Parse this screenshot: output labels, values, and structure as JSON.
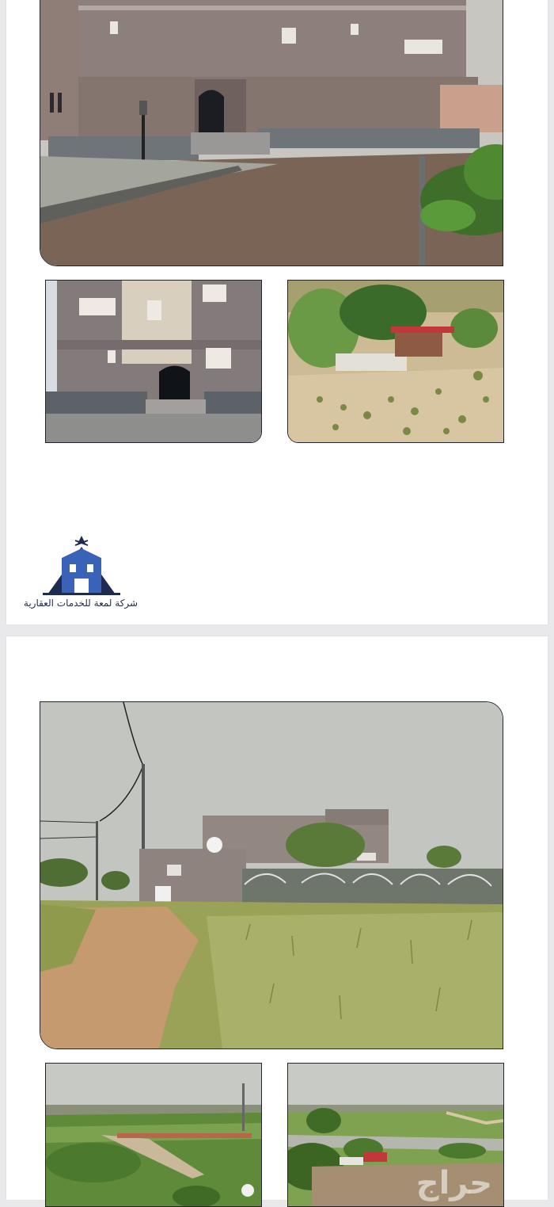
{
  "company": {
    "name": "شركة لمعة للخدمات العقارية",
    "logo_icon": "building-logo-icon"
  },
  "watermark": {
    "text": "حراج"
  },
  "pages": [
    {
      "photos": [
        {
          "subject": "villa-facade-front"
        },
        {
          "subject": "villa-side-entrance"
        },
        {
          "subject": "garden-with-shade"
        }
      ]
    },
    {
      "photos": [
        {
          "subject": "land-and-buildings-view"
        },
        {
          "subject": "farmland-panorama-left"
        },
        {
          "subject": "farmland-panorama-right"
        }
      ]
    }
  ],
  "colors": {
    "brand_navy": "#1e2a52",
    "brand_blue": "#3a63b8"
  }
}
